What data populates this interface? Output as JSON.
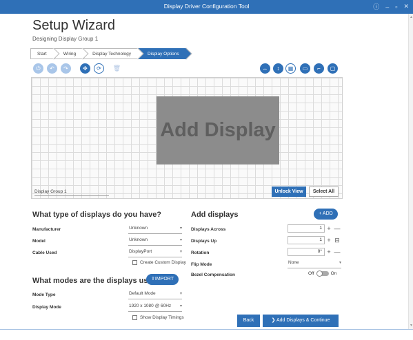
{
  "window": {
    "title": "Display Driver Configuration Tool",
    "controls": {
      "info": "ⓘ",
      "minimize": "–",
      "maximize": "▫",
      "close": "✕"
    }
  },
  "page": {
    "title": "Setup Wizard",
    "subtitle": "Designing Display Group 1"
  },
  "breadcrumbs": [
    "Start",
    "Wiring",
    "Display Technology",
    "Display Options"
  ],
  "breadcrumb_active": "Display Options",
  "toolbar_left": {
    "power": "⏻",
    "undo": "↶",
    "redo": "↷",
    "move": "✥",
    "rotate": "⟳",
    "trash": "🗑"
  },
  "toolbar_right": {
    "width": "↔",
    "height": "↕",
    "fit": "▦",
    "display": "▭",
    "corner": "⌐",
    "screen": "▢"
  },
  "canvas": {
    "placeholder": "Add Display",
    "group_name": "Display Group 1",
    "unlock_label": "Unlock View",
    "select_all_label": "Select All"
  },
  "display_types": {
    "title": "What type of displays do you have?",
    "manufacturer": {
      "label": "Manufacturer",
      "value": "Unknown"
    },
    "model": {
      "label": "Model",
      "value": "Unknown"
    },
    "cable": {
      "label": "Cable Used",
      "value": "DisplayPort"
    },
    "custom_display": "Create Custom Display"
  },
  "display_modes": {
    "title": "What modes are the displays using?",
    "import_label": "⇪IMPORT",
    "mode_type": {
      "label": "Mode Type",
      "value": "Default Mode"
    },
    "display_mode": {
      "label": "Display Mode",
      "value": "1920 x 1080 @ 60Hz"
    },
    "show_timings": "Show Display Timings"
  },
  "add_displays": {
    "title": "Add displays",
    "add_label": "+ ADD",
    "across": {
      "label": "Displays Across",
      "value": "1"
    },
    "up": {
      "label": "Displays Up",
      "value": "1"
    },
    "rotation": {
      "label": "Rotation",
      "value": "0°"
    },
    "flip": {
      "label": "Flip Mode",
      "value": "None"
    },
    "bezel": {
      "label": "Bezel Compensation",
      "off": "Off",
      "on": "On"
    }
  },
  "footer": {
    "back_label": "Back",
    "continue_label": "Add Displays & Continue",
    "continue_icon": "❯"
  },
  "colors": {
    "accent": "#2f70b7",
    "accent_light": "#a9c6e9",
    "grid": "#dcdcdc",
    "placeholder": "#8c8c8c"
  }
}
